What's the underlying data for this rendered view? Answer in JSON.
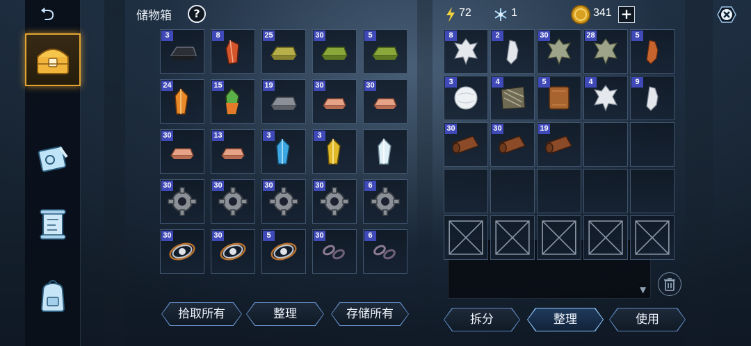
{
  "storage": {
    "title": "储物箱",
    "help_label": "?",
    "items": [
      {
        "qty": "3",
        "icon": "black-ingot-icon"
      },
      {
        "qty": "8",
        "icon": "red-crystal-icon"
      },
      {
        "qty": "25",
        "icon": "gold-ingot-icon"
      },
      {
        "qty": "30",
        "icon": "green-ingot-icon"
      },
      {
        "qty": "5",
        "icon": "green-ingot-icon"
      },
      {
        "qty": "24",
        "icon": "orange-crystal-icon"
      },
      {
        "qty": "15",
        "icon": "rainbow-crystal-icon"
      },
      {
        "qty": "19",
        "icon": "iron-ingot-icon"
      },
      {
        "qty": "30",
        "icon": "copper-ingot-icon"
      },
      {
        "qty": "30",
        "icon": "copper-ingot-icon"
      },
      {
        "qty": "30",
        "icon": "copper-ingot-icon"
      },
      {
        "qty": "13",
        "icon": "copper-ingot-icon"
      },
      {
        "qty": "3",
        "icon": "blue-crystal-icon"
      },
      {
        "qty": "3",
        "icon": "yellow-crystal-icon"
      },
      {
        "qty": "",
        "icon": "white-crystal-icon"
      },
      {
        "qty": "30",
        "icon": "gear-icon"
      },
      {
        "qty": "30",
        "icon": "gear-icon"
      },
      {
        "qty": "30",
        "icon": "gear-icon"
      },
      {
        "qty": "30",
        "icon": "gear-icon"
      },
      {
        "qty": "6",
        "icon": "gear-icon"
      },
      {
        "qty": "30",
        "icon": "spring-coil-icon"
      },
      {
        "qty": "30",
        "icon": "spring-coil-icon"
      },
      {
        "qty": "5",
        "icon": "spring-coil-icon"
      },
      {
        "qty": "30",
        "icon": "chain-links-icon"
      },
      {
        "qty": "6",
        "icon": "chain-links-icon"
      }
    ],
    "buttons": {
      "pickup_all": "拾取所有",
      "sort": "整理",
      "store_all": "存储所有"
    }
  },
  "header": {
    "energy": "72",
    "snowflake": "1",
    "coins": "341",
    "add_label": "+"
  },
  "inventory": {
    "items": [
      {
        "qty": "8",
        "icon": "white-pelt-icon"
      },
      {
        "qty": "2",
        "icon": "white-paw-pelt-icon"
      },
      {
        "qty": "30",
        "icon": "grey-pelt-icon"
      },
      {
        "qty": "28",
        "icon": "grey-pelt-icon"
      },
      {
        "qty": "5",
        "icon": "fox-pelt-icon"
      },
      {
        "qty": "3",
        "icon": "white-fur-icon"
      },
      {
        "qty": "4",
        "icon": "striped-fur-icon"
      },
      {
        "qty": "5",
        "icon": "leather-sheet-icon"
      },
      {
        "qty": "4",
        "icon": "white-pelt-icon"
      },
      {
        "qty": "9",
        "icon": "white-paw-pelt-icon"
      },
      {
        "qty": "30",
        "icon": "leather-roll-icon"
      },
      {
        "qty": "30",
        "icon": "leather-roll-icon"
      },
      {
        "qty": "19",
        "icon": "leather-roll-icon"
      },
      {
        "qty": "",
        "icon": ""
      },
      {
        "qty": "",
        "icon": ""
      },
      {
        "qty": "",
        "icon": ""
      },
      {
        "qty": "",
        "icon": ""
      },
      {
        "qty": "",
        "icon": ""
      },
      {
        "qty": "",
        "icon": ""
      },
      {
        "qty": "",
        "icon": ""
      },
      {
        "qty": "",
        "icon": "locked-slot-icon"
      },
      {
        "qty": "",
        "icon": "locked-slot-icon"
      },
      {
        "qty": "",
        "icon": "locked-slot-icon"
      },
      {
        "qty": "",
        "icon": "locked-slot-icon"
      },
      {
        "qty": "",
        "icon": "locked-slot-icon"
      }
    ],
    "buttons": {
      "split": "拆分",
      "sort": "整理",
      "use": "使用"
    }
  },
  "sidebar": {
    "tabs": [
      {
        "icon": "treasure-chest-icon",
        "active": true
      },
      {
        "icon": "blueprint-icon",
        "active": false
      },
      {
        "icon": "map-scroll-icon",
        "active": false
      },
      {
        "icon": "backpack-icon",
        "active": false
      }
    ]
  },
  "colors": {
    "qty_badge": "#3f49b8",
    "accent": "#e2a532",
    "button_border": "#5f8ac0"
  }
}
